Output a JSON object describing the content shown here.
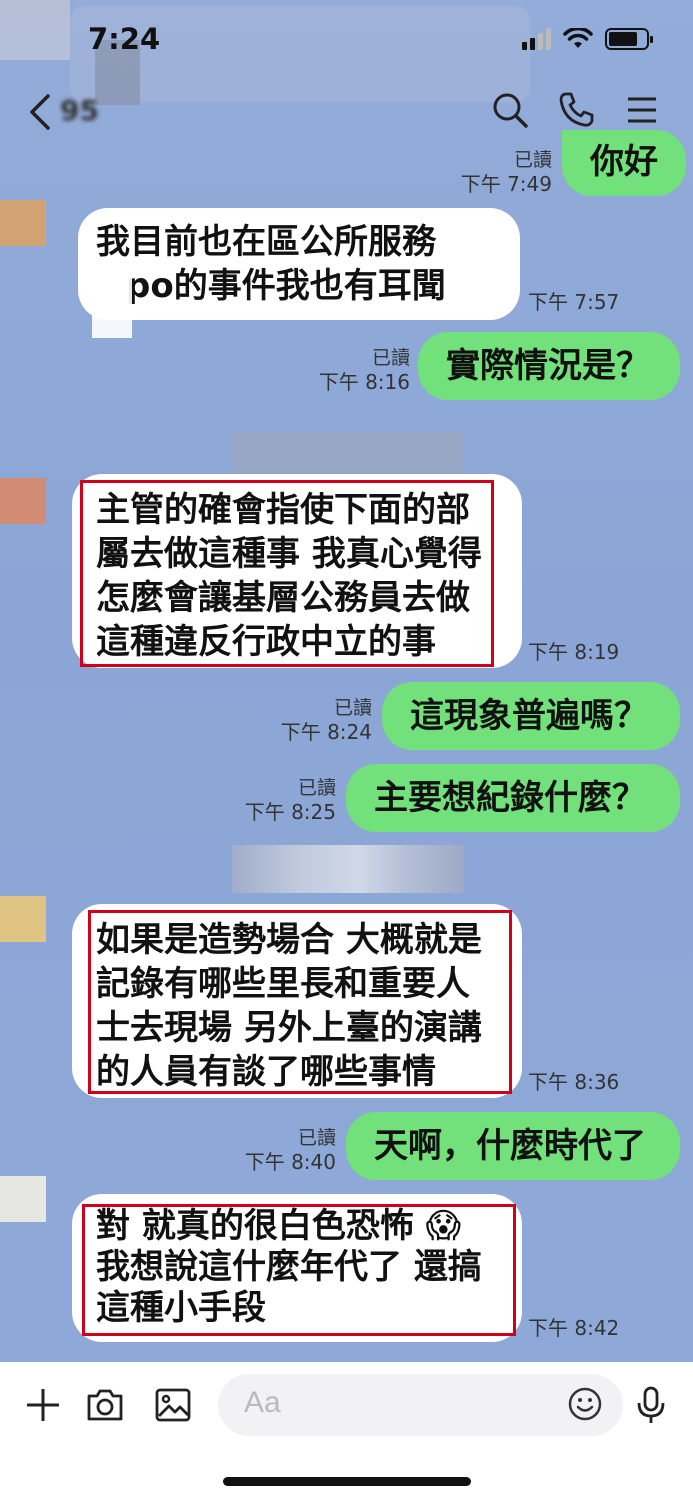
{
  "status_bar": {
    "time": "7:24"
  },
  "header": {
    "title": "95"
  },
  "messages": [
    {
      "dir": "out",
      "text": [
        "你好"
      ],
      "read": "已讀",
      "time": "下午 7:49"
    },
    {
      "dir": "in",
      "text": [
        "我目前也在區公所服務",
        "po的事件我也有耳聞"
      ],
      "time": "下午 7:57"
    },
    {
      "dir": "out",
      "text": [
        "實際情況是？"
      ],
      "read": "已讀",
      "time": "下午 8:16"
    },
    {
      "dir": "in",
      "text": [
        "主管的確會指使下面的部",
        "屬去做這種事 我真心覺得",
        "怎麼會讓基層公務員去做",
        "這種違反行政中立的事"
      ],
      "time": "下午 8:19"
    },
    {
      "dir": "out",
      "text": [
        "這現象普遍嗎？"
      ],
      "read": "已讀",
      "time": "下午 8:24"
    },
    {
      "dir": "out",
      "text": [
        "主要想紀錄什麼？"
      ],
      "read": "已讀",
      "time": "下午 8:25"
    },
    {
      "dir": "in",
      "text": [
        "如果是造勢場合 大概就是",
        "記錄有哪些里長和重要人",
        "士去現場 另外上臺的演講",
        "的人員有談了哪些事情"
      ],
      "time": "下午 8:36"
    },
    {
      "dir": "out",
      "text": [
        "天啊，什麼時代了"
      ],
      "read": "已讀",
      "time": "下午 8:40"
    },
    {
      "dir": "in",
      "text": [
        "對 就真的很白色恐怖 😱",
        "我想說這什麼年代了 還搞",
        "這種小手段"
      ],
      "time": "下午 8:42"
    }
  ],
  "input": {
    "placeholder": "Aa"
  },
  "colors": {
    "background": "#8ea9d8",
    "outgoing": "#72e07b",
    "incoming": "#ffffff",
    "highlight": "#d0021b"
  }
}
